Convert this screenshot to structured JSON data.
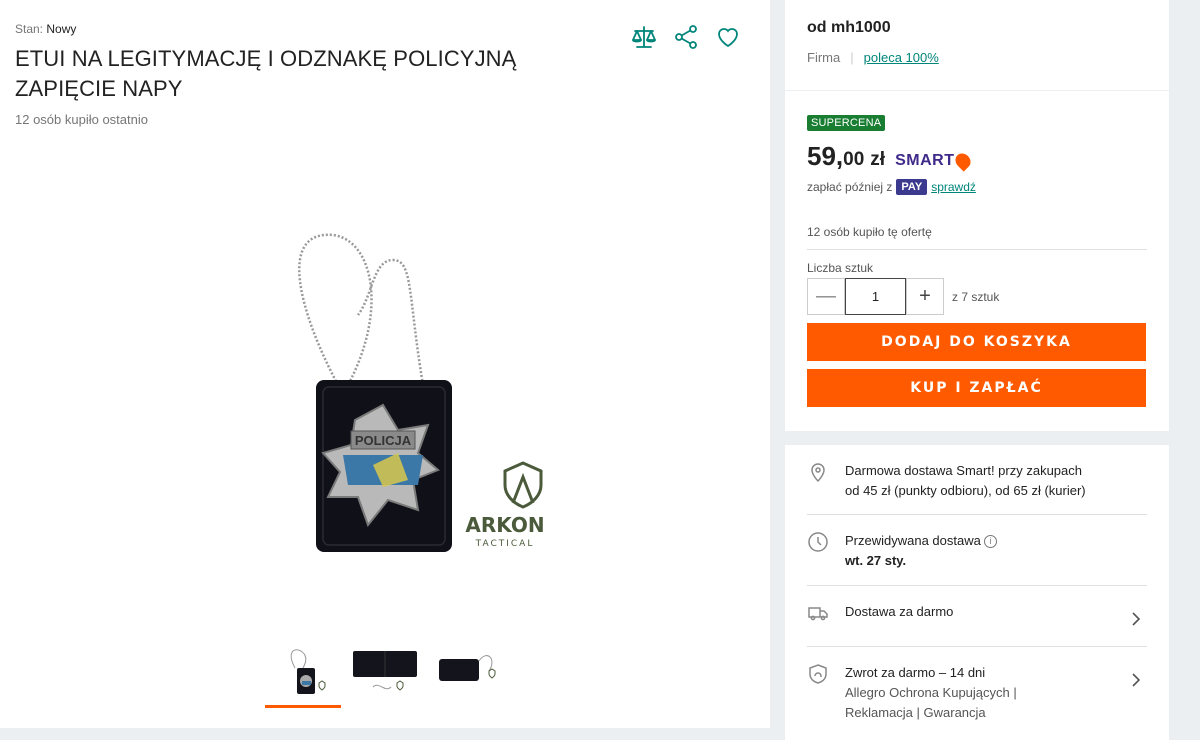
{
  "product": {
    "condition_label": "Stan:",
    "condition_value": "Nowy",
    "title": "ETUI NA LEGITYMACJĘ I ODZNAKĘ POLICYJNĄ ZAPIĘCIE NAPY",
    "bought_recently": "12 osób kupiło ostatnio",
    "image_brand": "ARKON",
    "image_brand_sub": "TACTICAL",
    "badge_text": "POLICJA",
    "active_thumbnail_index": 0,
    "thumbnail_count": 3
  },
  "icons": {
    "compare": "scales-icon",
    "share": "share-icon",
    "favorite": "heart-icon"
  },
  "seller": {
    "name": "od mh1000",
    "type": "Firma",
    "recommend": "poleca 100%"
  },
  "offer": {
    "badge": "SUPERCENA",
    "price_main": "59,",
    "price_cents": "00",
    "currency": "zł",
    "smart_label": "SMART",
    "pay_later_text": "zapłać później z",
    "pay_logo": "PAY",
    "pay_link": "sprawdź",
    "offer_bought": "12 osób kupiło tę ofertę",
    "qty_label": "Liczba sztuk",
    "qty_value": "1",
    "qty_minus": "—",
    "qty_plus": "+",
    "qty_of": "z 7 sztuk",
    "add_to_cart": "DODAJ DO KOSZYKA",
    "buy_now": "KUP I ZAPŁAĆ"
  },
  "delivery": {
    "free_smart_line1": "Darmowa dostawa Smart! przy zakupach",
    "free_smart_line2": "od 45 zł (punkty odbioru), od 65 zł (kurier)",
    "estimated_label": "Przewidywana dostawa",
    "estimated_date": "wt. 27 sty.",
    "free_delivery": "Dostawa za darmo",
    "returns": "Zwrot za darmo – 14 dni",
    "returns_sub1": "Allegro Ochrona Kupujących |",
    "returns_sub2": "Reklamacja | Gwarancja"
  },
  "colors": {
    "accent": "#ff5a00",
    "teal": "#00857a",
    "badge_green": "#1a7e32",
    "smart_purple": "#3f2a8a"
  }
}
